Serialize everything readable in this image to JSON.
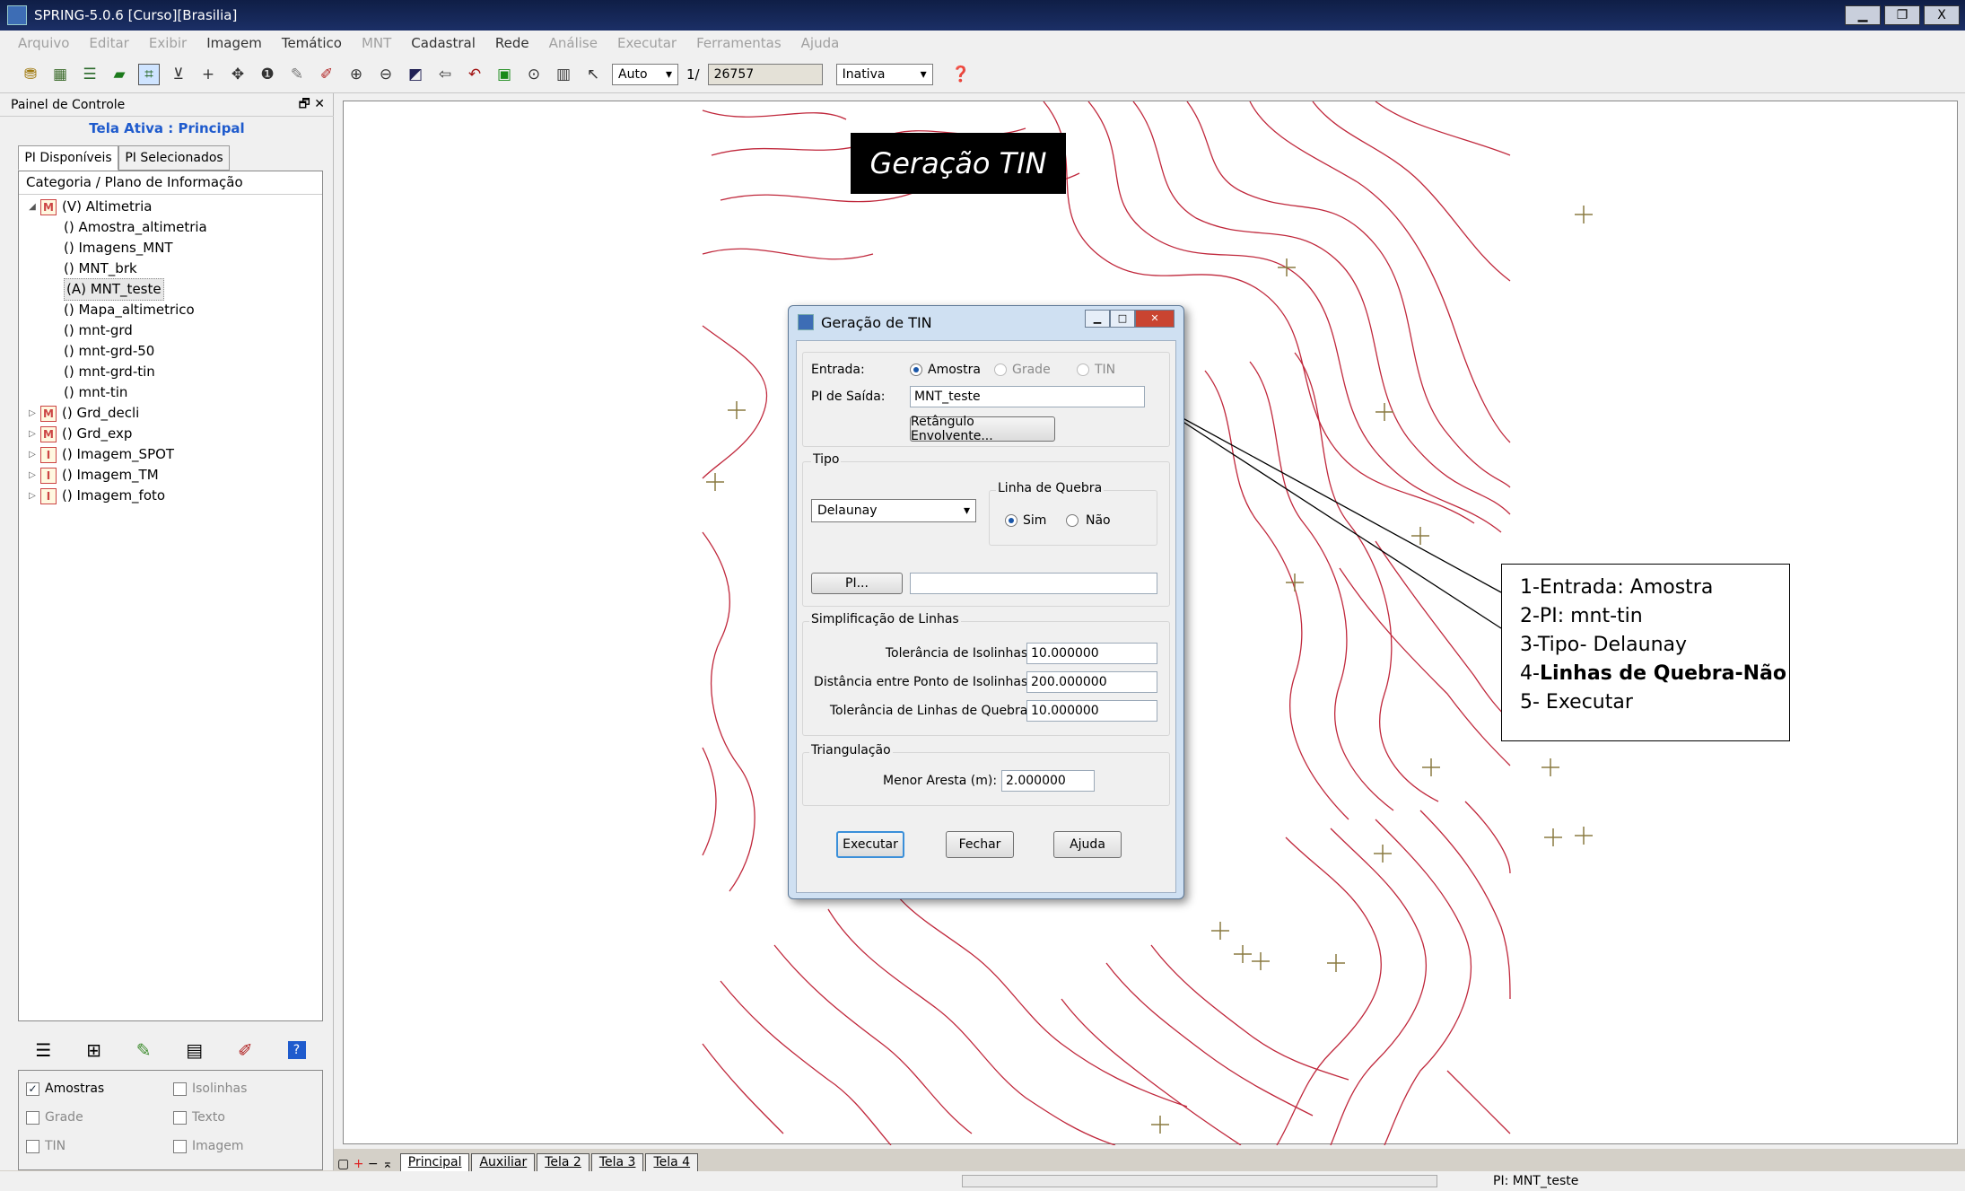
{
  "window": {
    "title": "SPRING-5.0.6 [Curso][Brasilia]"
  },
  "menu": [
    "Arquivo",
    "Editar",
    "Exibir",
    "Imagem",
    "Temático",
    "MNT",
    "Cadastral",
    "Rede",
    "Análise",
    "Executar",
    "Ferramentas",
    "Ajuda"
  ],
  "menu_enabled": [
    false,
    false,
    false,
    true,
    true,
    false,
    true,
    true,
    false,
    false,
    false,
    false
  ],
  "toolbar": {
    "scale_mode": "Auto",
    "scale_sep": "1/",
    "scale_value": "26757",
    "state": "Inativa"
  },
  "panel": {
    "title": "Painel de Controle",
    "active_screen": "Tela Ativa : Principal",
    "tabs": [
      "PI Disponíveis",
      "PI Selecionados"
    ],
    "tree_header": "Categoria / Plano de Informação",
    "tree": [
      {
        "label": "(V) Altimetria",
        "level": 0,
        "badge": "M",
        "expanded": true
      },
      {
        "label": "() Amostra_altimetria",
        "level": 1
      },
      {
        "label": "() Imagens_MNT",
        "level": 1
      },
      {
        "label": "() MNT_brk",
        "level": 1
      },
      {
        "label": "(A) MNT_teste",
        "level": 1,
        "selected": true
      },
      {
        "label": "() Mapa_altimetrico",
        "level": 1
      },
      {
        "label": "() mnt-grd",
        "level": 1
      },
      {
        "label": "() mnt-grd-50",
        "level": 1
      },
      {
        "label": "() mnt-grd-tin",
        "level": 1
      },
      {
        "label": "() mnt-tin",
        "level": 1
      },
      {
        "label": "() Grd_decli",
        "level": 0,
        "badge": "M"
      },
      {
        "label": "() Grd_exp",
        "level": 0,
        "badge": "M"
      },
      {
        "label": "() Imagem_SPOT",
        "level": 0,
        "badge": "I"
      },
      {
        "label": "() Imagem_TM",
        "level": 0,
        "badge": "I"
      },
      {
        "label": "() Imagem_foto",
        "level": 0,
        "badge": "I"
      }
    ],
    "visibility": [
      {
        "label": "Amostras",
        "checked": true,
        "enabled": true
      },
      {
        "label": "Isolinhas",
        "checked": false,
        "enabled": false
      },
      {
        "label": "Grade",
        "checked": false,
        "enabled": false
      },
      {
        "label": "Texto",
        "checked": false,
        "enabled": false
      },
      {
        "label": "TIN",
        "checked": false,
        "enabled": false
      },
      {
        "label": "Imagem",
        "checked": false,
        "enabled": false
      }
    ]
  },
  "view_tabs": [
    "Principal",
    "Auxiliar",
    "Tela 2",
    "Tela 3",
    "Tela 4"
  ],
  "overlay_title": "Geração TIN",
  "dialog": {
    "title": "Geração de TIN",
    "entrada_label": "Entrada:",
    "entrada_options": [
      "Amostra",
      "Grade",
      "TIN"
    ],
    "pi_saida_label": "PI de Saída:",
    "pi_saida_value": "MNT_teste",
    "retangulo_button": "Retângulo Envolvente...",
    "tipo_label": "Tipo",
    "tipo_value": "Delaunay",
    "linha_quebra_label": "Linha de Quebra",
    "linha_quebra_options": [
      "Sim",
      "Não"
    ],
    "pi_button": "PI...",
    "pi_value": "",
    "simplificacao_label": "Simplificação de Linhas",
    "tol_isolinhas_label": "Tolerância de Isolinhas:",
    "tol_isolinhas_value": "10.000000",
    "dist_label": "Distância entre Ponto de Isolinhas:",
    "dist_value": "200.000000",
    "tol_quebra_label": "Tolerância de Linhas de Quebra:",
    "tol_quebra_value": "10.000000",
    "triangulacao_label": "Triangulação",
    "menor_aresta_label": "Menor Aresta (m):",
    "menor_aresta_value": "2.000000",
    "executar": "Executar",
    "fechar": "Fechar",
    "ajuda": "Ajuda"
  },
  "callout": {
    "line1": "1-Entrada: Amostra",
    "line2": "2-PI: mnt-tin",
    "line3": "3-Tipo- Delaunay",
    "line4_prefix": "4-",
    "line4_bold": "Linhas de Quebra-Não",
    "line5": "5- Executar"
  },
  "status": {
    "pi": "PI: MNT_teste"
  },
  "colors": {
    "contour": "#c0283c",
    "sample_marker": "#8a7a40",
    "title_bar": "#12244f",
    "active_label": "#1f5bcd"
  }
}
